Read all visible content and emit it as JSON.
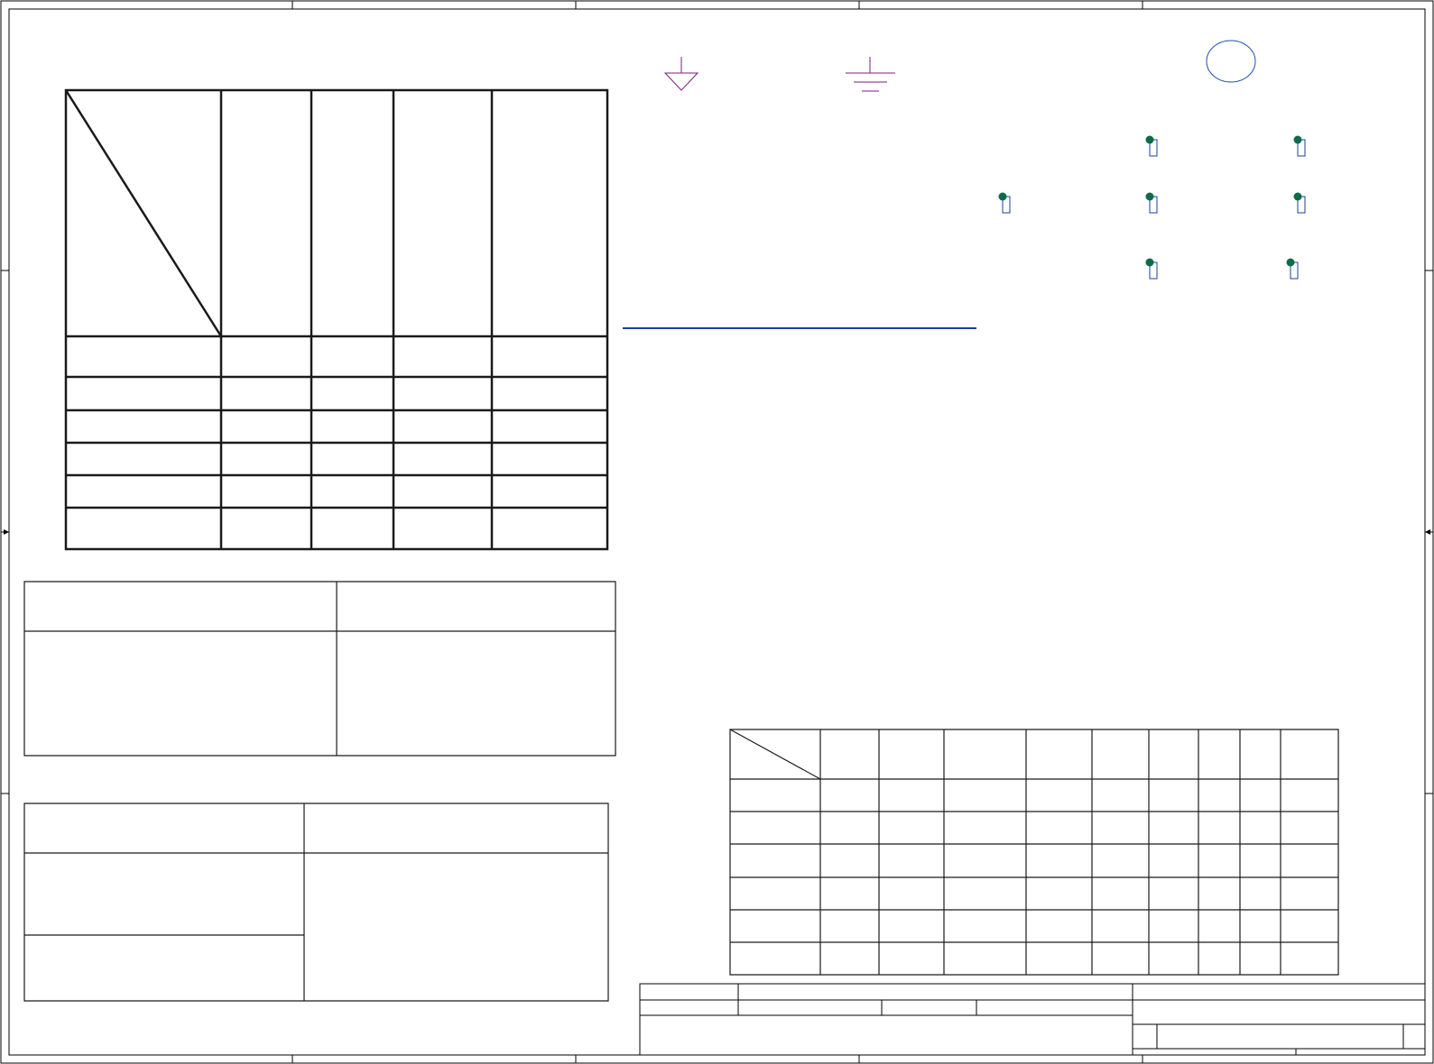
{
  "sheet": {
    "title": "",
    "border_color": "#000000",
    "table_line_color": "#1a1a1a",
    "power_symbol_color": "#7a1f7a",
    "junction_color": "#0b6b4b",
    "pin_color": "#1b3f9b",
    "wire_color": "#1b3f9b",
    "circle_color": "#1b4fb0"
  },
  "symbols": [
    "signal-ground-icon",
    "earth-ground-icon",
    "circle-marker-icon",
    "junction-dot-icon",
    "pin-rectangle-icon"
  ]
}
